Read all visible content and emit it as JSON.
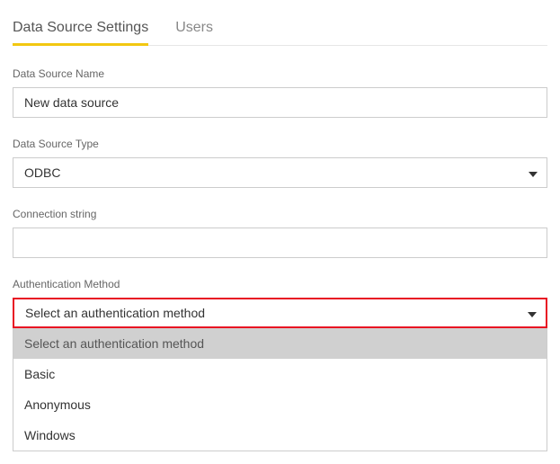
{
  "tabs": {
    "settings": "Data Source Settings",
    "users": "Users"
  },
  "fields": {
    "name_label": "Data Source Name",
    "name_value": "New data source",
    "type_label": "Data Source Type",
    "type_value": "ODBC",
    "conn_label": "Connection string",
    "conn_value": "",
    "auth_label": "Authentication Method",
    "auth_selected": "Select an authentication method"
  },
  "auth_options": {
    "placeholder": "Select an authentication method",
    "basic": "Basic",
    "anonymous": "Anonymous",
    "windows": "Windows"
  }
}
